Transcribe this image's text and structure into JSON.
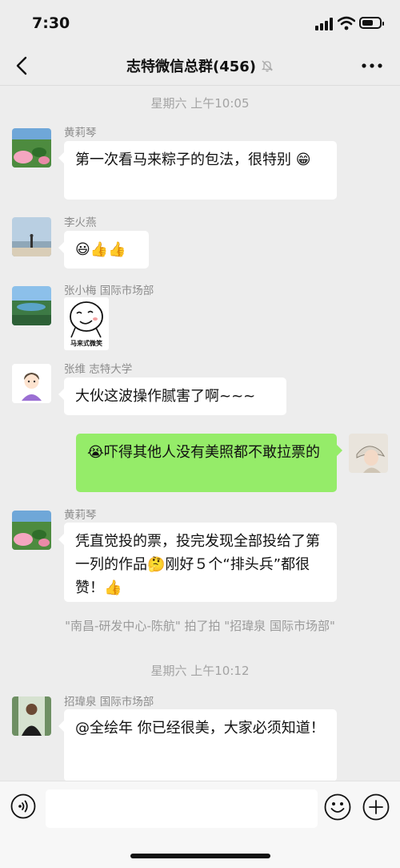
{
  "status_bar": {
    "time": "7:30"
  },
  "header": {
    "title": "志特微信总群(456)"
  },
  "timestamps": [
    "星期六 上午10:05",
    "星期六 上午10:12"
  ],
  "messages": [
    {
      "sender": "黄莉琴",
      "text": "第一次看马来粽子的包法，很特别",
      "emoji": "😁"
    },
    {
      "sender": "李火燕",
      "text": "",
      "emoji": "😃👍👍"
    },
    {
      "sender": "张小梅  国际市场部",
      "sticker_caption": "马来式微笑"
    },
    {
      "sender": "张维  志特大学",
      "text": "大伙这波操作腻害了啊~~~"
    },
    {
      "sender": "",
      "emoji": "😭",
      "text": "吓得其他人没有美照都不敢拉票的"
    },
    {
      "sender": "黄莉琴",
      "text_1": "凭直觉投的票，投完发现全部投给了第一列的作品",
      "emoji_1": "🤔",
      "text_2": "刚好５个“排头兵”都很赞！",
      "emoji_2": "👍"
    },
    {
      "sender": "招瑋泉  国际市场部",
      "text": "@全绘年 你已经很美，大家必须知道！"
    }
  ],
  "system_message": "\"南昌-研发中心-陈航\" 拍了拍 \"招瑋泉 国际市场部\"",
  "input": {
    "placeholder": ""
  },
  "icons": {
    "back": "chevron-left-icon",
    "mute": "bell-off-icon",
    "more": "more-dots-icon",
    "voice": "voice-icon",
    "emoji": "emoji-icon",
    "plus": "plus-icon"
  },
  "colors": {
    "background": "#ededed",
    "bubble_self": "#95ec69",
    "bubble_other": "#ffffff"
  }
}
